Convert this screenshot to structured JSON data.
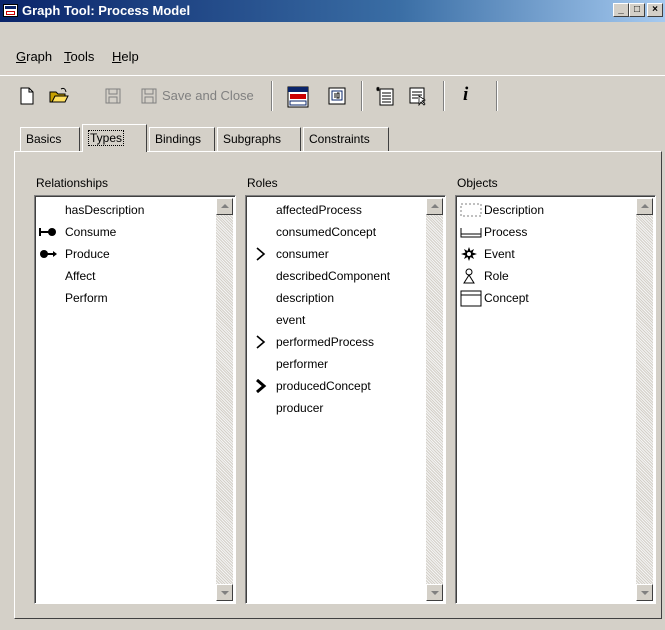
{
  "window": {
    "title": "Graph Tool: Process Model",
    "minimize_glyph": "_",
    "maximize_glyph": "□",
    "close_glyph": "×"
  },
  "menu": {
    "graph": {
      "mnemonic": "G",
      "rest": "raph"
    },
    "tools": {
      "mnemonic": "T",
      "rest": "ools"
    },
    "help": {
      "mnemonic": "H",
      "rest": "elp"
    }
  },
  "toolbar": {
    "save_and_close_label": "Save and Close",
    "info_label": "i"
  },
  "tabs": [
    {
      "label": "Basics",
      "active": false
    },
    {
      "label": "Types",
      "active": true
    },
    {
      "label": "Bindings",
      "active": false
    },
    {
      "label": "Subgraphs",
      "active": false
    },
    {
      "label": "Constraints",
      "active": false
    }
  ],
  "relationships": {
    "label": "Relationships",
    "items": [
      {
        "label": "hasDescription",
        "icon": "none"
      },
      {
        "label": "Consume",
        "icon": "consume-arrow-icon"
      },
      {
        "label": "Produce",
        "icon": "produce-arrow-icon"
      },
      {
        "label": "Affect",
        "icon": "none"
      },
      {
        "label": "Perform",
        "icon": "none"
      }
    ]
  },
  "roles": {
    "label": "Roles",
    "items": [
      {
        "label": "affectedProcess",
        "icon": "none"
      },
      {
        "label": "consumedConcept",
        "icon": "none"
      },
      {
        "label": "consumer",
        "icon": "chevron-right-icon"
      },
      {
        "label": "describedComponent",
        "icon": "none"
      },
      {
        "label": "description",
        "icon": "none"
      },
      {
        "label": "event",
        "icon": "none"
      },
      {
        "label": "performedProcess",
        "icon": "chevron-right-icon"
      },
      {
        "label": "performer",
        "icon": "none"
      },
      {
        "label": "producedConcept",
        "icon": "bold-chevron-right-icon"
      },
      {
        "label": "producer",
        "icon": "none"
      }
    ]
  },
  "objects": {
    "label": "Objects",
    "items": [
      {
        "label": "Description",
        "icon": "dashed-box-icon"
      },
      {
        "label": "Process",
        "icon": "process-bracket-icon"
      },
      {
        "label": "Event",
        "icon": "starburst-icon"
      },
      {
        "label": "Role",
        "icon": "person-icon"
      },
      {
        "label": "Concept",
        "icon": "concept-box-icon"
      }
    ]
  }
}
